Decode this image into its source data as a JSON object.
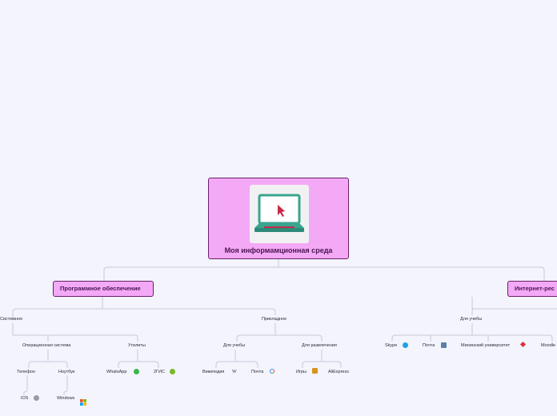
{
  "root": {
    "title": "Моя информамционная среда",
    "icon": "laptop-cursor-icon"
  },
  "branches": {
    "software": "Программное обеспечение",
    "internet": "Интернет-рес"
  },
  "nodes": {
    "system": "Системное",
    "applied": "Прикладное",
    "os": "Операционная система",
    "utilities": "Утилиты",
    "for_study_left": "Для учебы",
    "entertainment": "Для развлечения",
    "phone": "Телефон",
    "laptop": "Ноутбук",
    "ios": "IOS",
    "windows": "Windows",
    "whatsapp": "WhatsApp",
    "twogis": "2ГИС",
    "wikipedia": "Википедия",
    "mail_left": "Почта",
    "games": "Игры",
    "aliexpress": "AliExpress",
    "for_study_right": "Для учебы",
    "skype": "Skype",
    "mail_right": "Почта",
    "minin": "Мининский университет",
    "moodle": "Moodle"
  },
  "colors": {
    "node_fill": "#f4a9f7",
    "node_border": "#6b1f6b",
    "connector": "#c5cad8",
    "background": "#f3f4fc"
  }
}
